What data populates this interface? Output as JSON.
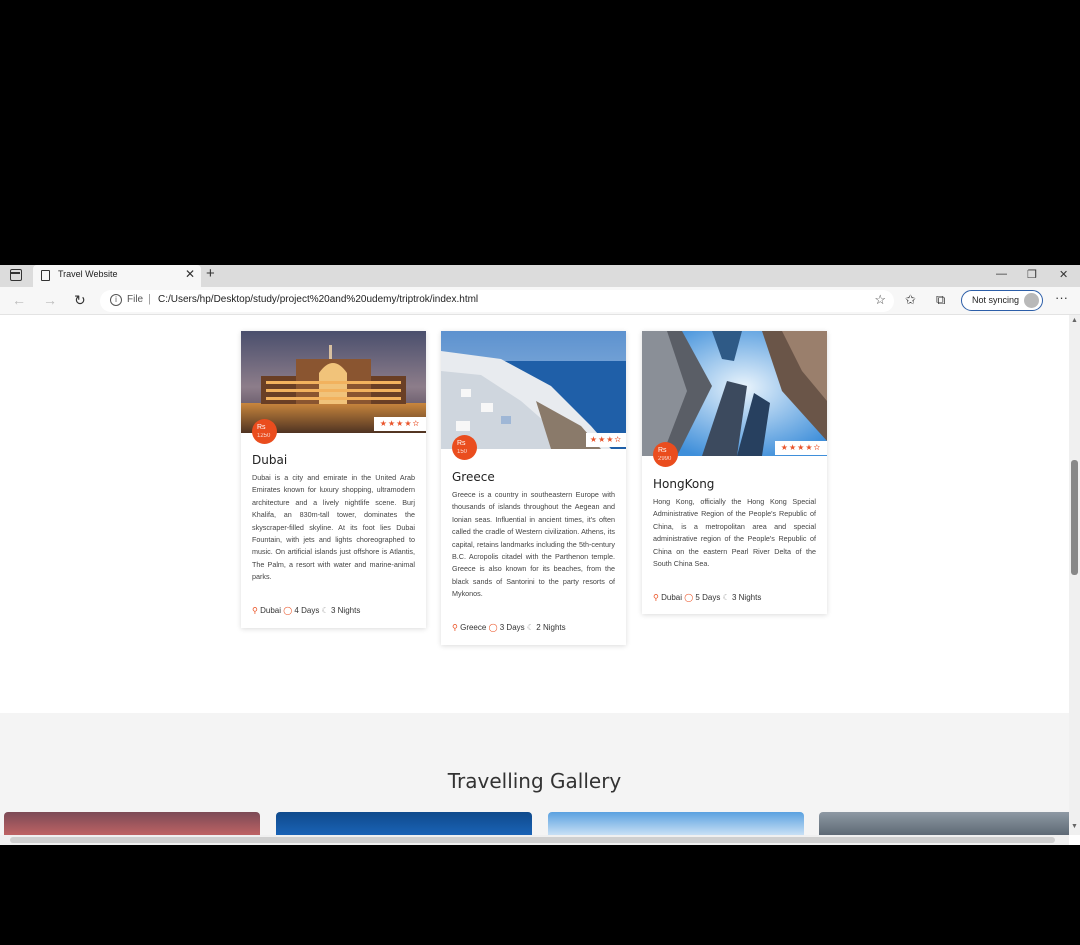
{
  "browser": {
    "tab_title": "Travel Website",
    "tab_close": "✕",
    "new_tab": "+",
    "address_scheme": "File",
    "address_sep": "|",
    "url": "C:/Users/hp/Desktop/study/project%20and%20udemy/triptrok/index.html",
    "sync_label": "Not syncing",
    "minimize": "—",
    "restore": "❐",
    "close": "✕",
    "more": "···"
  },
  "cards": [
    {
      "name": "Dubai",
      "price_label": "Rs",
      "price_value": "1250",
      "rating": "★★★★✫",
      "description": "Dubai is a city and emirate in the United Arab Emirates known for luxury shopping, ultramodern architecture and a lively nightlife scene. Burj Khalifa, an 830m-tall tower, dominates the skyscraper-filled skyline. At its foot lies Dubai Fountain, with jets and lights choreographed to music. On artificial islands just offshore is Atlantis, The Palm, a resort with water and marine-animal parks.",
      "location": "Dubai",
      "days": "4 Days",
      "nights": "3 Nights"
    },
    {
      "name": "Greece",
      "price_label": "Rs",
      "price_value": "150",
      "rating": "★★★✫",
      "description": "Greece is a country in southeastern Europe with thousands of islands throughout the Aegean and Ionian seas. Influential in ancient times, it's often called the cradle of Western civilization. Athens, its capital, retains landmarks including the 5th-century B.C. Acropolis citadel with the Parthenon temple. Greece is also known for its beaches, from the black sands of Santorini to the party resorts of Mykonos.",
      "location": "Greece",
      "days": "3 Days",
      "nights": "2 Nights"
    },
    {
      "name": "HongKong",
      "price_label": "Rs",
      "price_value": "2990",
      "rating": "★★★★✫",
      "description": "Hong Kong, officially the Hong Kong Special Administrative Region of the People's Republic of China, is a metropolitan area and special administrative region of the People's Republic of China on the eastern Pearl River Delta of the South China Sea.",
      "location": "Dubai",
      "days": "5 Days",
      "nights": "3 Nights"
    }
  ],
  "gallery": {
    "title": "Travelling Gallery"
  }
}
